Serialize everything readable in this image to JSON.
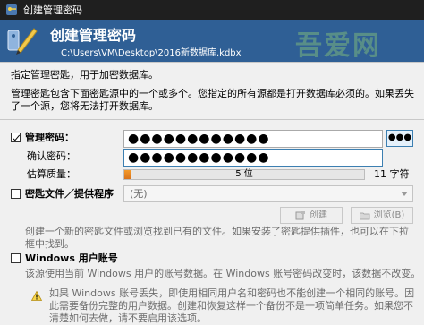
{
  "window": {
    "title": "创建管理密码"
  },
  "banner": {
    "heading": "创建管理密码",
    "path": "C:\\Users\\VM\\Desktop\\2016新数据库.kdbx",
    "watermark": "吾爱网"
  },
  "intro": {
    "line1": "指定管理密匙，用于加密数据库。",
    "line2a": "管理密匙包含下面密匙源中的一个或多个。您指定的所有源都是打开数据库必须的。如果丢失",
    "line2b": "了一个源，您将无法打开数据库。"
  },
  "master_password": {
    "label": "管理密码：",
    "checked": true,
    "value": "●●●●●●●●●●●●",
    "toggle_label": "●●●"
  },
  "confirm_password": {
    "label": "确认密码：",
    "value": "●●●●●●●●●●●●"
  },
  "quality": {
    "label": "估算质量：",
    "bar_text": "5 位",
    "fraction": 0.03,
    "chars": "11 字符"
  },
  "keyfile": {
    "label": "密匙文件／提供程序",
    "checked": false,
    "selected": "(无)",
    "create_label": "创建",
    "browse_label": "浏览(B)",
    "desc1": "创建一个新的密匙文件或浏览找到已有的文件。如果安装了密匙提供插件，也可以在下拉",
    "desc2": "框中找到。"
  },
  "windows_account": {
    "label": "Windows 用户账号",
    "checked": false,
    "desc": "该源使用当前 Windows 用户的账号数据。在 Windows 账号密码改变时，该数据不改变。",
    "warn1": "如果 Windows 账号丢失，即使用相同用户名和密码也不能创建一个相同的账号。因",
    "warn2": "此需要备份完整的用户数据。创建和恢复这样一个备份不是一项简单任务。如果您不",
    "warn3": "清楚如何去做，请不要启用该选项。"
  },
  "colors": {
    "banner": "#2f5f95",
    "titlebar": "#1f1f1f",
    "quality_fill": "#e8861f",
    "focus_border": "#3c7fb1"
  }
}
